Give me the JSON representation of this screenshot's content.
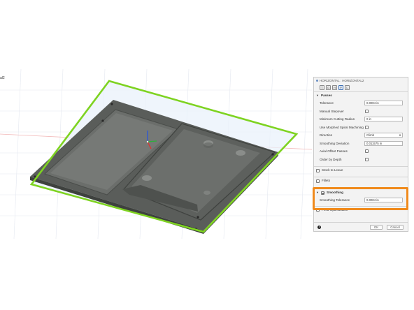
{
  "viewport": {
    "label": "al2"
  },
  "panel": {
    "title": "HORIZONTAL : HORIZONTAL2",
    "tabs": [
      "tool-tab",
      "geometry-tab",
      "heights-tab",
      "passes-tab",
      "linking-tab"
    ],
    "passes": {
      "header": "Passes",
      "rows": [
        {
          "label": "Tolerance",
          "type": "input",
          "value": "0.0004 in"
        },
        {
          "label": "Manual Stepover",
          "type": "checkbox",
          "checked": false
        },
        {
          "label": "Minimum Cutting Radius",
          "type": "input",
          "value": "0 in"
        },
        {
          "label": "Use Morphed Spiral Machining",
          "type": "checkbox",
          "checked": false
        },
        {
          "label": "Direction",
          "type": "select",
          "value": "Climb"
        },
        {
          "label": "Smoothing Deviation",
          "type": "input",
          "value": "0.011575 in"
        },
        {
          "label": "Axial Offset Passes",
          "type": "checkbox",
          "checked": false
        },
        {
          "label": "Order by Depth",
          "type": "checkbox",
          "checked": false
        }
      ]
    },
    "stock_to_leave": {
      "label": "Stock to Leave",
      "checked": false
    },
    "fillets": {
      "label": "Fillets",
      "checked": false
    },
    "smoothing": {
      "label": "Smoothing",
      "checked": true,
      "tolerance_label": "Smoothing Tolerance",
      "tolerance_value": "0.0004 in"
    },
    "feed_optimization": {
      "label": "Feed Optimization",
      "checked": false
    },
    "buttons": {
      "ok": "OK",
      "cancel": "Cancel"
    }
  },
  "colors": {
    "highlight": "#f08a1c",
    "selection_outline": "#7ed321",
    "part_body": "#5f625f",
    "axis_x": "#e03030",
    "axis_y": "#2bb23a",
    "axis_z": "#2a55d9"
  }
}
